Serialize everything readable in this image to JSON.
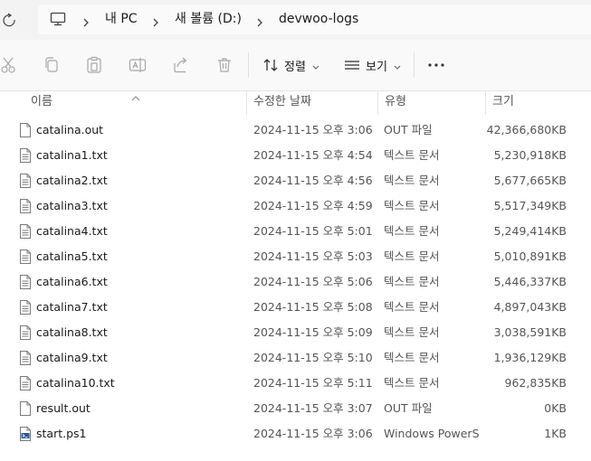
{
  "breadcrumb": {
    "items": [
      "내 PC",
      "새 볼륨 (D:)",
      "devwoo-logs"
    ]
  },
  "toolbar": {
    "sort_label": "정렬",
    "view_label": "보기"
  },
  "columns": {
    "name": "이름",
    "date": "수정한 날짜",
    "type": "유형",
    "size": "크기"
  },
  "files": [
    {
      "name": "catalina.out",
      "date": "2024-11-15 오후 3:06",
      "type": "OUT 파일",
      "size": "42,366,680KB",
      "icon": "generic-file-icon"
    },
    {
      "name": "catalina1.txt",
      "date": "2024-11-15 오후 4:54",
      "type": "텍스트 문서",
      "size": "5,230,918KB",
      "icon": "text-file-icon"
    },
    {
      "name": "catalina2.txt",
      "date": "2024-11-15 오후 4:56",
      "type": "텍스트 문서",
      "size": "5,677,665KB",
      "icon": "text-file-icon"
    },
    {
      "name": "catalina3.txt",
      "date": "2024-11-15 오후 4:59",
      "type": "텍스트 문서",
      "size": "5,517,349KB",
      "icon": "text-file-icon"
    },
    {
      "name": "catalina4.txt",
      "date": "2024-11-15 오후 5:01",
      "type": "텍스트 문서",
      "size": "5,249,414KB",
      "icon": "text-file-icon"
    },
    {
      "name": "catalina5.txt",
      "date": "2024-11-15 오후 5:03",
      "type": "텍스트 문서",
      "size": "5,010,891KB",
      "icon": "text-file-icon"
    },
    {
      "name": "catalina6.txt",
      "date": "2024-11-15 오후 5:06",
      "type": "텍스트 문서",
      "size": "5,446,337KB",
      "icon": "text-file-icon"
    },
    {
      "name": "catalina7.txt",
      "date": "2024-11-15 오후 5:08",
      "type": "텍스트 문서",
      "size": "4,897,043KB",
      "icon": "text-file-icon"
    },
    {
      "name": "catalina8.txt",
      "date": "2024-11-15 오후 5:09",
      "type": "텍스트 문서",
      "size": "3,038,591KB",
      "icon": "text-file-icon"
    },
    {
      "name": "catalina9.txt",
      "date": "2024-11-15 오후 5:10",
      "type": "텍스트 문서",
      "size": "1,936,129KB",
      "icon": "text-file-icon"
    },
    {
      "name": "catalina10.txt",
      "date": "2024-11-15 오후 5:11",
      "type": "텍스트 문서",
      "size": "962,835KB",
      "icon": "text-file-icon"
    },
    {
      "name": "result.out",
      "date": "2024-11-15 오후 3:07",
      "type": "OUT 파일",
      "size": "0KB",
      "icon": "generic-file-icon"
    },
    {
      "name": "start.ps1",
      "date": "2024-11-15 오후 3:06",
      "type": "Windows PowerS...",
      "size": "1KB",
      "icon": "powershell-file-icon"
    }
  ]
}
